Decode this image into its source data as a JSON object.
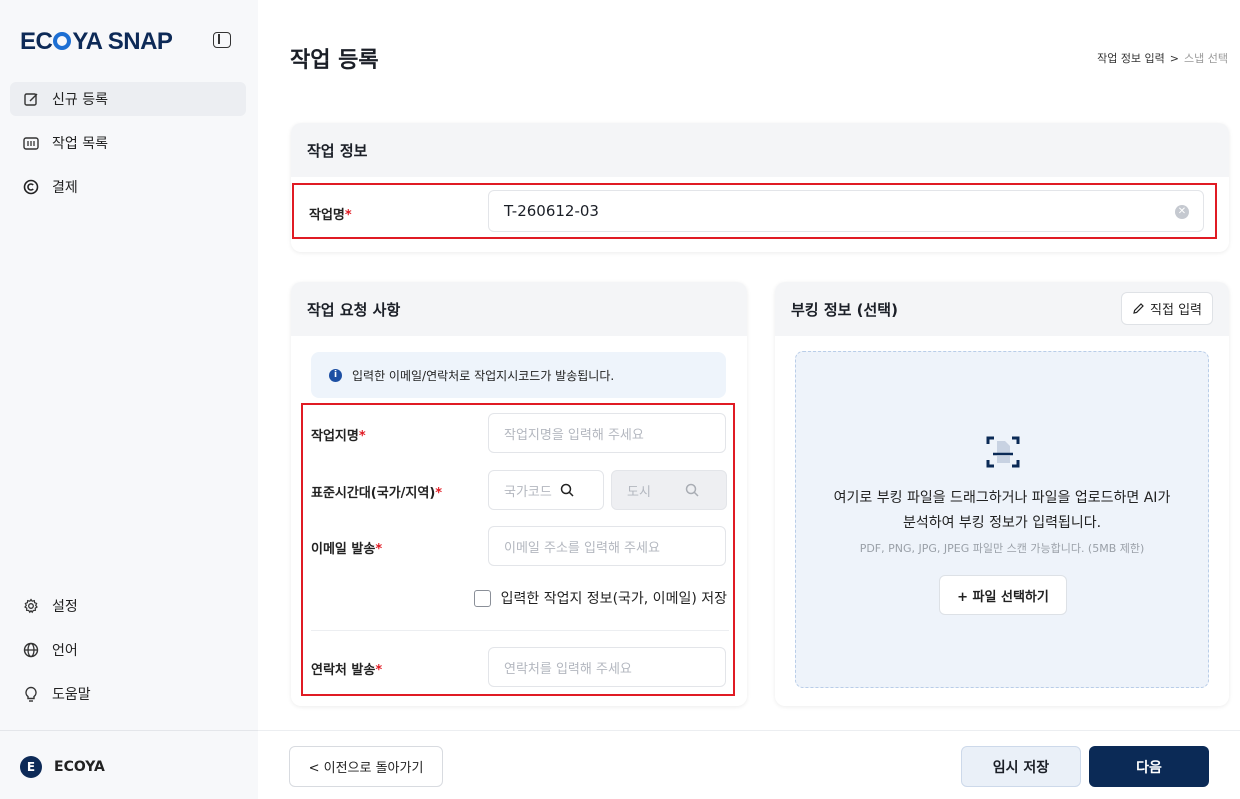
{
  "sidebar": {
    "logo": "ECOYA SNAP",
    "logo_parts": {
      "pre": "EC",
      "post": "YA SNAP"
    },
    "items": [
      {
        "label": "신규 등록",
        "icon": "edit-icon"
      },
      {
        "label": "작업 목록",
        "icon": "list-icon"
      },
      {
        "label": "결제",
        "icon": "copyright-icon"
      }
    ],
    "bottom_items": [
      {
        "label": "설정",
        "icon": "gear-icon"
      },
      {
        "label": "언어",
        "icon": "globe-icon"
      },
      {
        "label": "도움말",
        "icon": "lightbulb-icon"
      }
    ],
    "user": {
      "initial": "E",
      "name": "ECOYA"
    }
  },
  "header": {
    "title": "작업 등록",
    "breadcrumb": {
      "step1": "작업 정보 입력",
      "sep": ">",
      "step2": "스냅 선택"
    }
  },
  "job_info": {
    "title": "작업 정보",
    "name_label": "작업명",
    "required_mark": "*",
    "name_value": "T-260612-03"
  },
  "request": {
    "title": "작업 요청 사항",
    "info": "입력한 이메일/연락처로 작업지시코드가 발송됩니다.",
    "site_label": "작업지명",
    "site_placeholder": "작업지명을 입력해 주세요",
    "tz_label": "표준시간대(국가/지역)",
    "country_placeholder": "국가코드",
    "city_placeholder": "도시",
    "email_label": "이메일 발송",
    "email_placeholder": "이메일 주소를 입력해 주세요",
    "save_label": "입력한 작업지 정보(국가, 이메일) 저장",
    "contact_label": "연락처 발송",
    "contact_placeholder": "연락처를 입력해 주세요"
  },
  "booking": {
    "title": "부킹 정보 (선택)",
    "direct_button": "직접 입력",
    "drop_line1": "여기로 부킹 파일을 드래그하거나 파일을 업로드하면 AI가",
    "drop_line2": "분석하여 부킹 정보가 입력됩니다.",
    "drop_sub": "PDF, PNG, JPG, JPEG 파일만 스캔 가능합니다. (5MB 제한)",
    "pick_button": "+ 파일 선택하기"
  },
  "footer": {
    "back": "< 이전으로 돌아가기",
    "temp_save": "임시 저장",
    "next": "다음"
  },
  "colors": {
    "brand": "#0b2a56",
    "accent": "#1d6fd3",
    "highlight": "#e01b24"
  }
}
